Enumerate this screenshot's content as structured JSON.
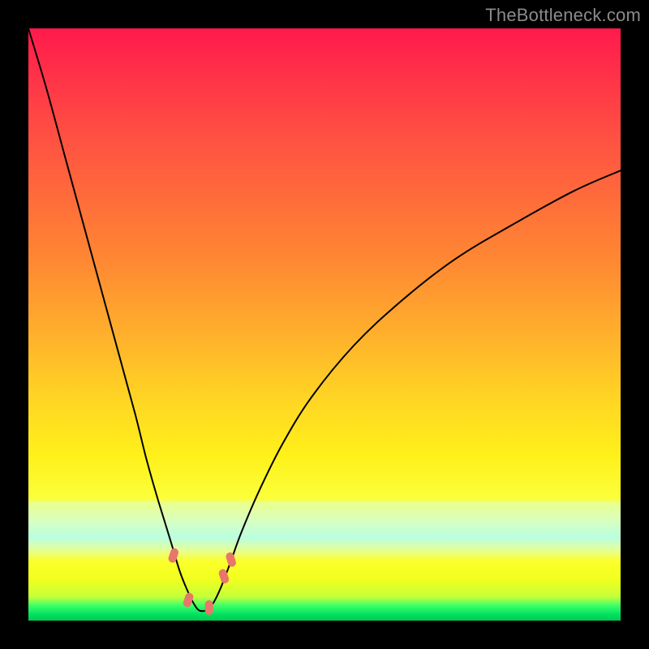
{
  "watermark": "TheBottleneck.com",
  "colors": {
    "background_frame": "#000000",
    "gradient_top": "#ff1a4c",
    "gradient_mid": "#ffd324",
    "gradient_bottom": "#00c850",
    "curve": "#000000",
    "markers": "#e9766a"
  },
  "chart_data": {
    "type": "line",
    "title": "",
    "xlabel": "",
    "ylabel": "",
    "xlim": [
      0,
      100
    ],
    "ylim": [
      0,
      100
    ],
    "series": [
      {
        "name": "bottleneck-curve",
        "x": [
          0,
          3,
          6,
          9,
          12,
          15,
          18,
          20,
          22,
          24,
          25.5,
          26.8,
          27.8,
          28.6,
          29.4,
          30.3,
          31.3,
          32.5,
          34,
          36,
          39,
          43,
          48,
          55,
          63,
          72,
          82,
          92,
          100
        ],
        "y": [
          100,
          90,
          79,
          68,
          57,
          46,
          35,
          27,
          20,
          13.5,
          8.5,
          5.2,
          3.1,
          1.9,
          1.6,
          1.9,
          3.1,
          5.6,
          9.5,
          15,
          22,
          30,
          38,
          46.5,
          54,
          61,
          67,
          72.5,
          76
        ]
      }
    ],
    "annotations": [
      {
        "name": "left-slope-marker",
        "x": 24.5,
        "y": 11
      },
      {
        "name": "vertex-left-marker",
        "x": 27.0,
        "y": 3.5
      },
      {
        "name": "vertex-right-marker",
        "x": 30.5,
        "y": 2.2
      },
      {
        "name": "right-slope-marker",
        "x": 33.0,
        "y": 7.5
      },
      {
        "name": "upper-right-marker",
        "x": 34.2,
        "y": 10.3
      }
    ]
  }
}
